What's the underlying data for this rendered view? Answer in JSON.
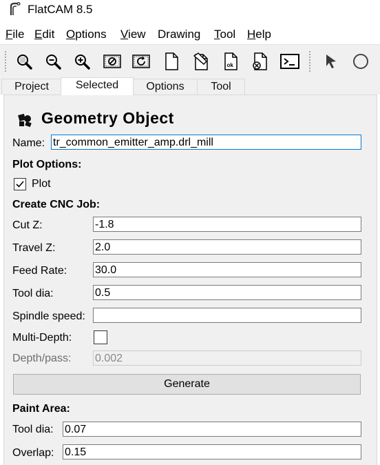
{
  "window": {
    "title": "FlatCAM 8.5"
  },
  "menu": [
    {
      "mnemonic": "F",
      "rest": "ile"
    },
    {
      "mnemonic": "E",
      "rest": "dit"
    },
    {
      "mnemonic": "O",
      "rest": "ptions"
    },
    {
      "mnemonic": "V",
      "rest": "iew"
    },
    {
      "mnemonic": "",
      "rest": "Drawing"
    },
    {
      "mnemonic": "T",
      "rest": "ool"
    },
    {
      "mnemonic": "H",
      "rest": "elp"
    }
  ],
  "toolbar": {
    "icons": [
      "zoom-fit-icon",
      "zoom-out-icon",
      "zoom-in-icon",
      "clear-plot-icon",
      "replot-icon",
      "new-project-icon",
      "edit-geometry-icon",
      "update-geometry-icon",
      "delete-icon",
      "shell-icon",
      "select-arrow-icon",
      "circle-icon"
    ],
    "ok_label": "ok"
  },
  "tabs": [
    "Project",
    "Selected",
    "Options",
    "Tool"
  ],
  "active_tab": "Selected",
  "panel": {
    "title": "Geometry Object",
    "name_label": "Name:",
    "name_value": "tr_common_emitter_amp.drl_mill",
    "plot_options_label": "Plot Options:",
    "plot_label": "Plot",
    "plot_checked": true,
    "cnc_label": "Create CNC Job:",
    "cut_z_label": "Cut Z:",
    "cut_z_value": "-1.8",
    "travel_z_label": "Travel Z:",
    "travel_z_value": "2.0",
    "feed_rate_label": "Feed Rate:",
    "feed_rate_value": "30.0",
    "tool_dia_label": "Tool dia:",
    "tool_dia_value": "0.5",
    "spindle_label": "Spindle speed:",
    "spindle_value": "",
    "multi_depth_label": "Multi-Depth:",
    "multi_depth_checked": false,
    "depth_pass_label": "Depth/pass:",
    "depth_pass_value": "0.002",
    "generate_label": "Generate",
    "paint_label": "Paint Area:",
    "paint_tool_dia_label": "Tool dia:",
    "paint_tool_dia_value": "0.07",
    "overlap_label": "Overlap:",
    "overlap_value": "0.15"
  },
  "colors": {
    "focus_border": "#0078d7",
    "panel_bg": "#f0f0f0",
    "toolbar_bg": "#f0f0f0"
  }
}
